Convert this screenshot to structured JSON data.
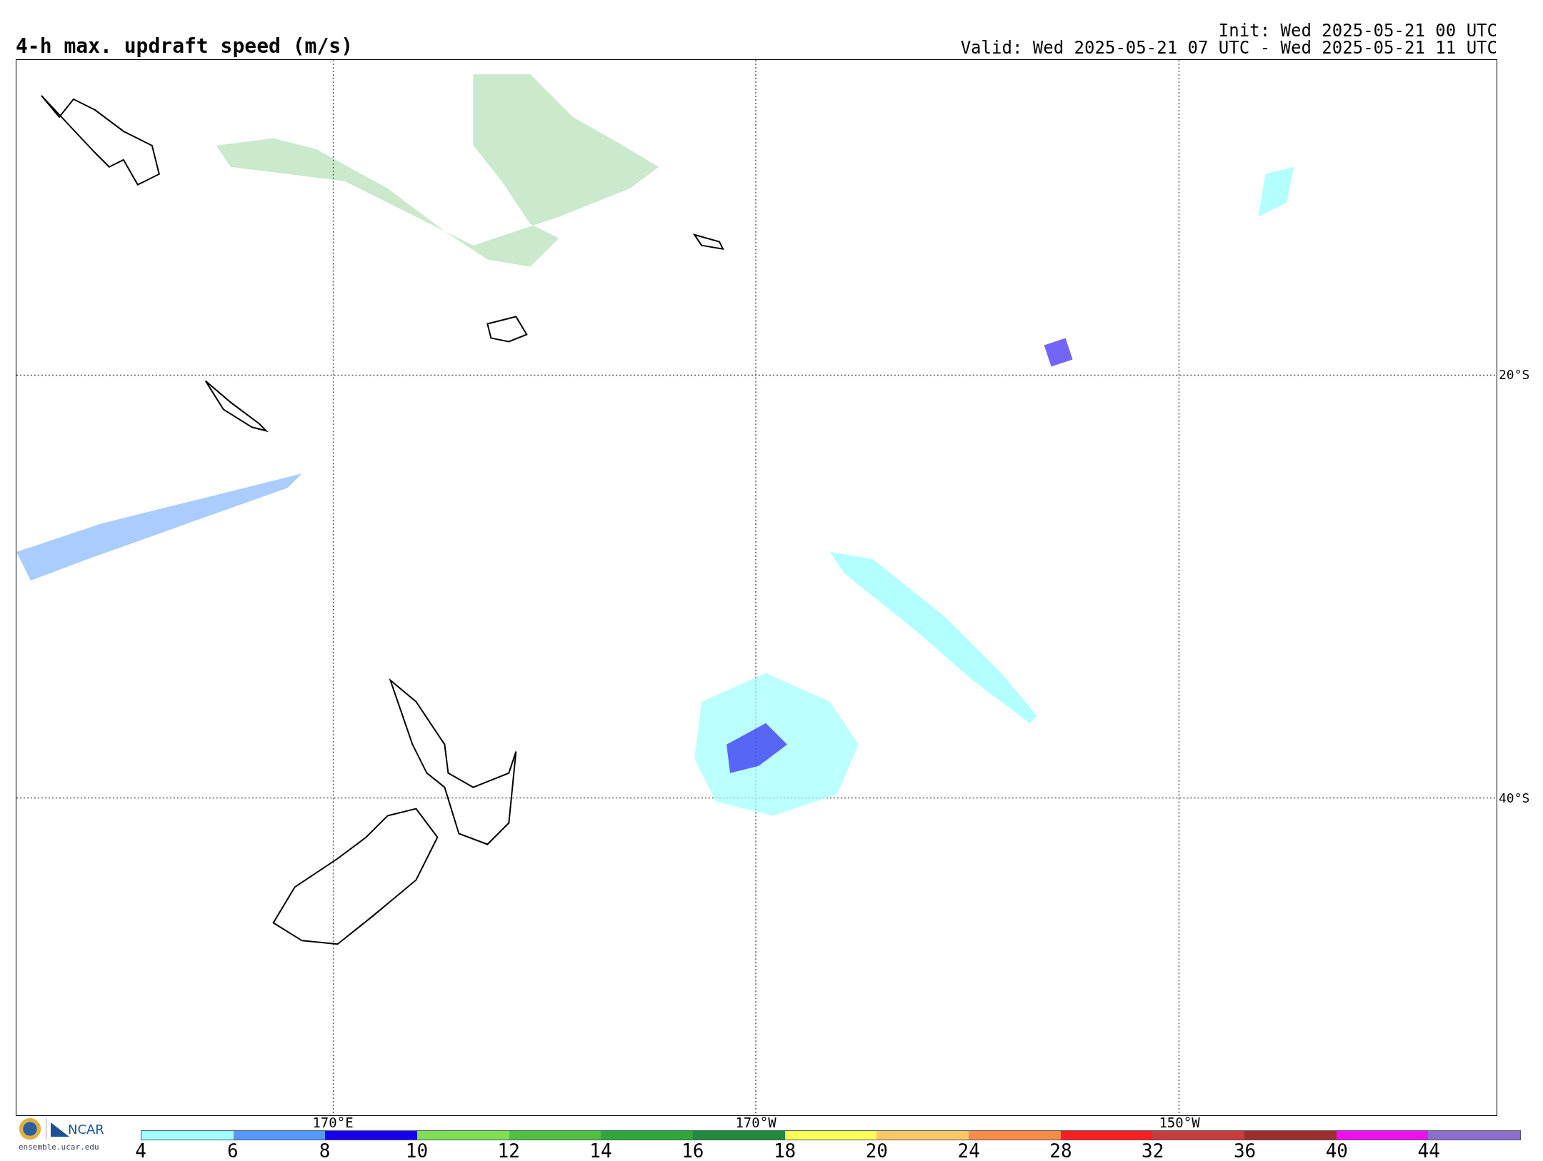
{
  "title": "4-h max. updraft speed (m/s)",
  "init": "Init: Wed 2025-05-21 00 UTC",
  "valid": "Valid: Wed 2025-05-21 07 UTC - Wed 2025-05-21 11 UTC",
  "map": {
    "lat_labels": [
      "20°S",
      "40°S"
    ],
    "lon_labels": [
      "170°E",
      "170°W",
      "150°W"
    ]
  },
  "logo": {
    "name": "NCAR",
    "url": "ensemble.ucar.edu"
  },
  "colorbar": {
    "segments": [
      {
        "color": "#a0ffff"
      },
      {
        "color": "#5599ff"
      },
      {
        "color": "#1500f0"
      },
      {
        "color": "#7ee050"
      },
      {
        "color": "#4cc240"
      },
      {
        "color": "#2fa838"
      },
      {
        "color": "#1e8c3a"
      },
      {
        "color": "#ffff55"
      },
      {
        "color": "#ffc864"
      },
      {
        "color": "#ff8c46"
      },
      {
        "color": "#ff1e1e"
      },
      {
        "color": "#c83c3c"
      },
      {
        "color": "#a02d2d"
      },
      {
        "color": "#f00ff0"
      },
      {
        "color": "#8c6ecc"
      }
    ],
    "ticks": [
      "4",
      "6",
      "8",
      "10",
      "12",
      "14",
      "16",
      "18",
      "20",
      "24",
      "28",
      "32",
      "36",
      "40",
      "44"
    ]
  }
}
